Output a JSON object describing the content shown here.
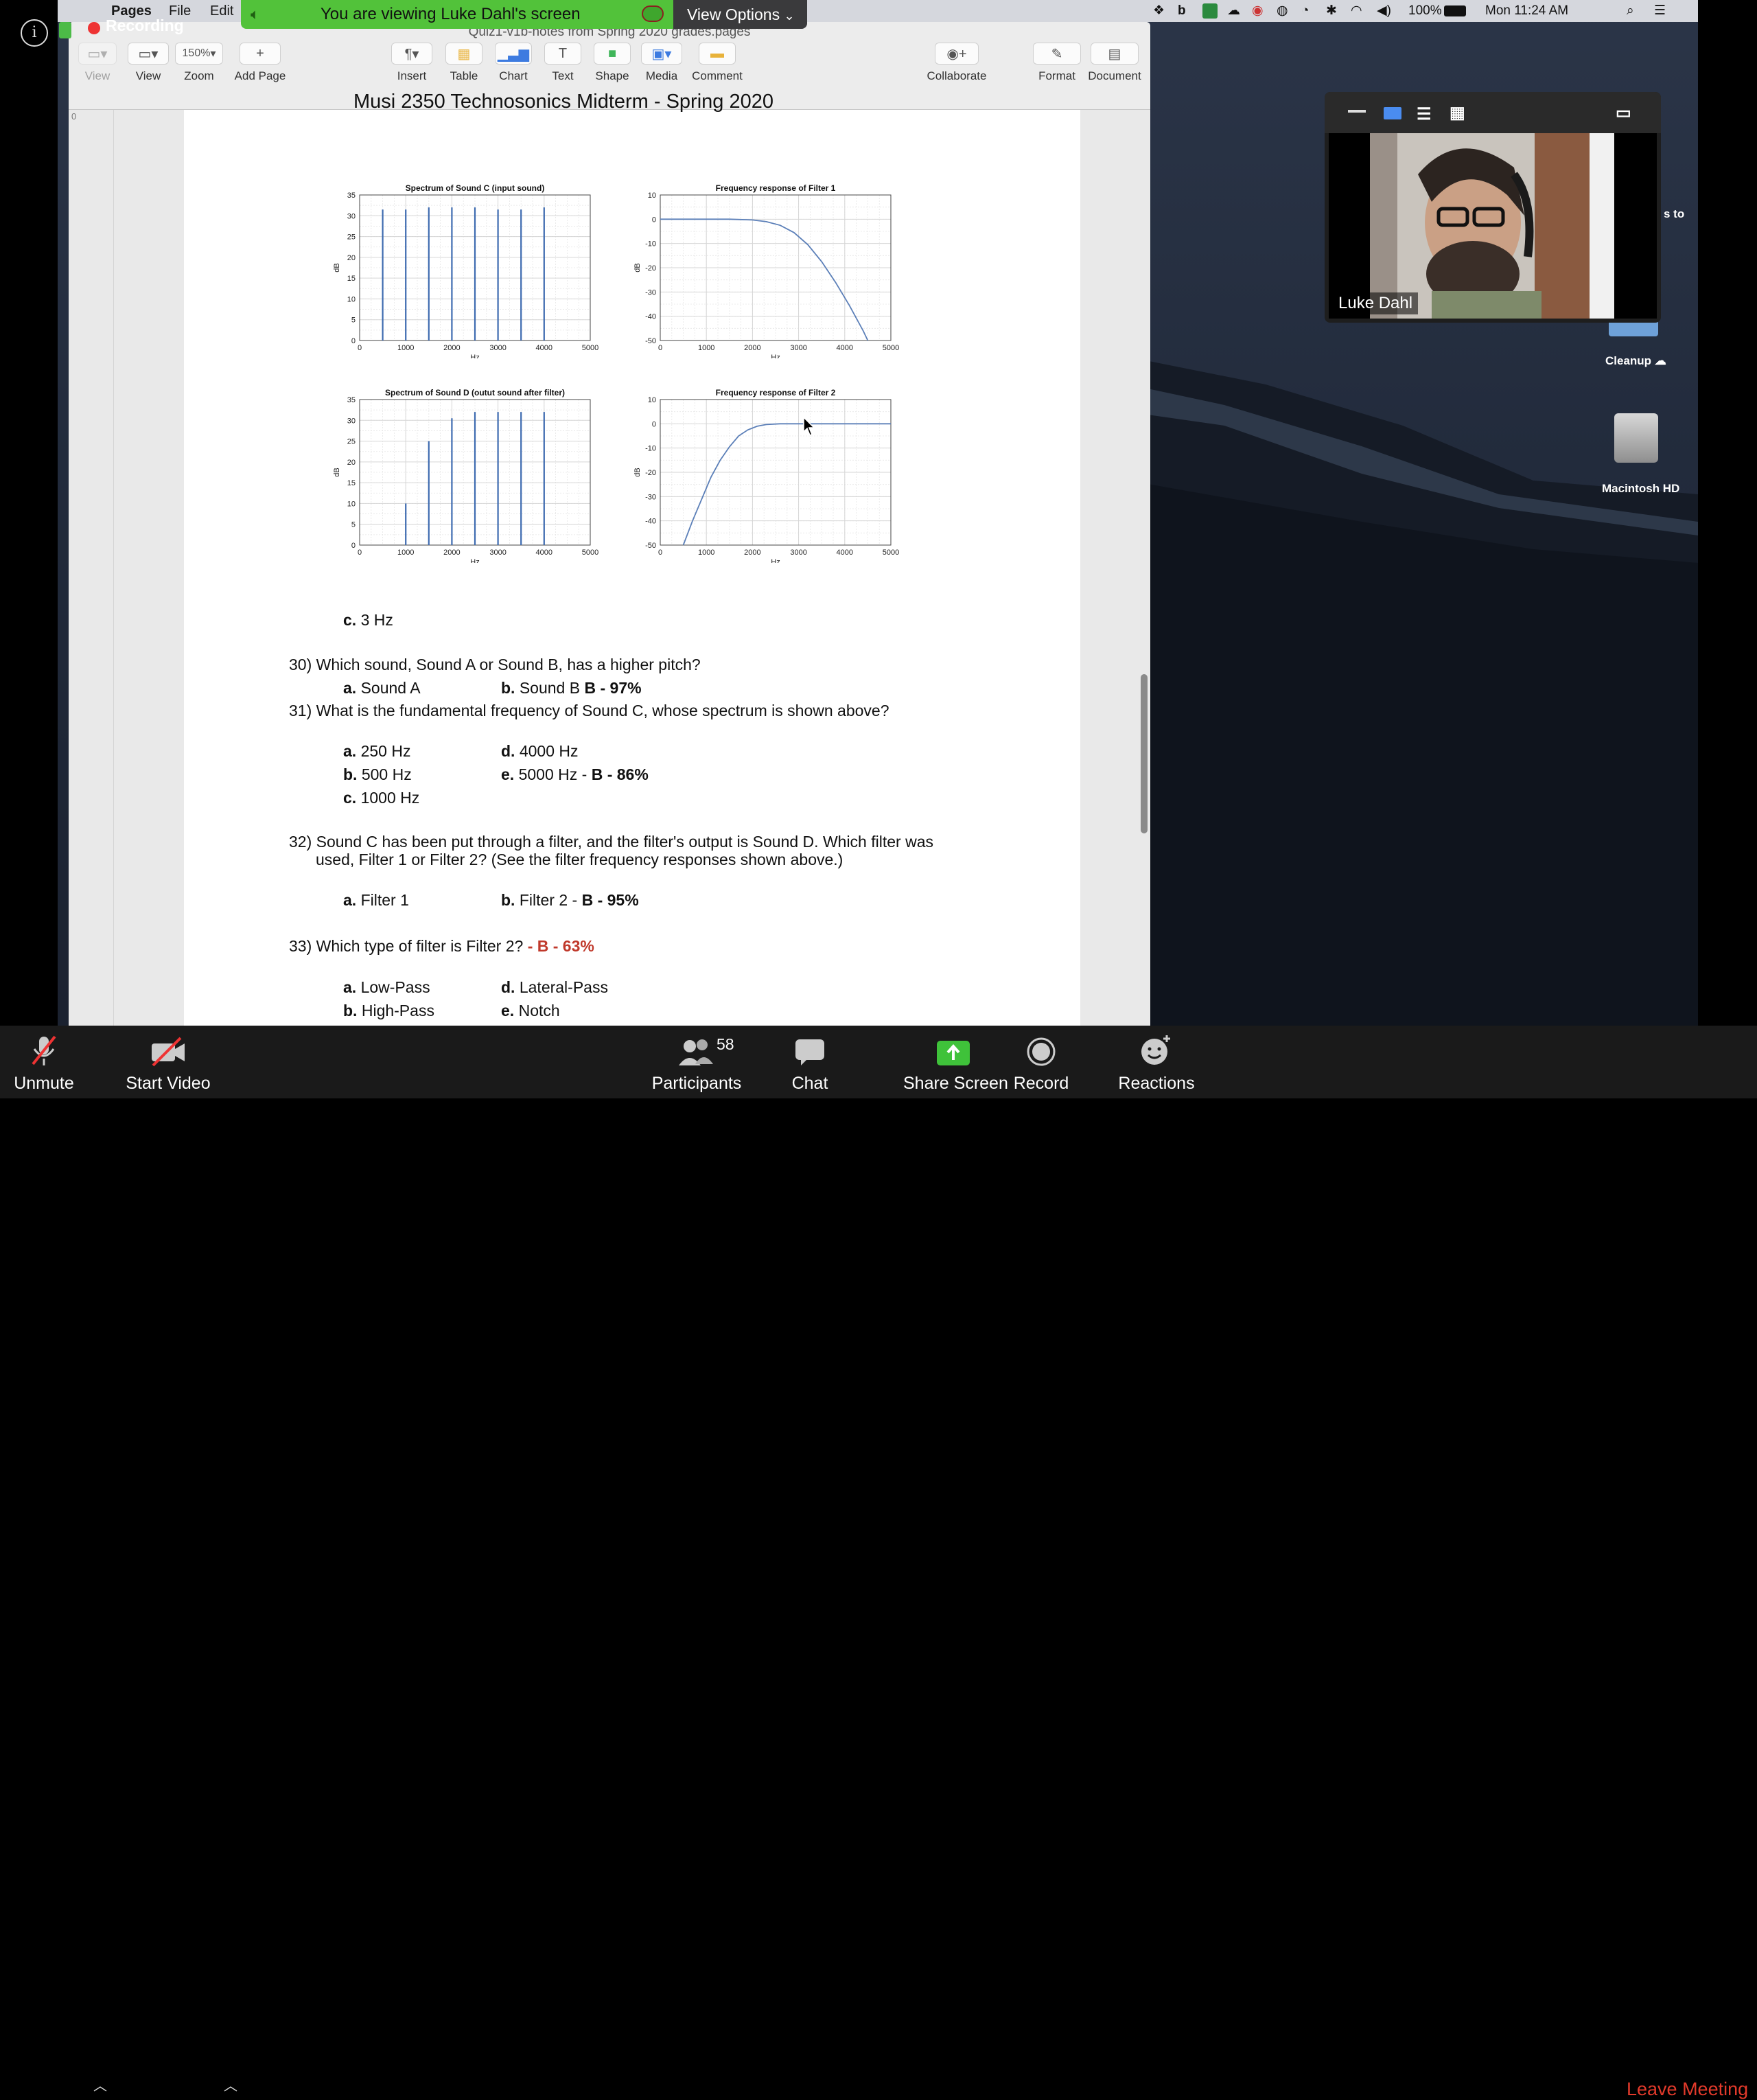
{
  "menubar": {
    "app_name": "Pages",
    "menus": [
      "File",
      "Edit"
    ],
    "battery": "100%",
    "clock": "Mon 11:24 AM"
  },
  "zoom_banner": {
    "viewing_text": "You are viewing Luke Dahl's screen",
    "view_options_label": "View Options",
    "recording_label": "Recording"
  },
  "pages": {
    "window_title": "Quiz1-v1b-notes from Spring 2020 grades.pages",
    "toolbar": {
      "view": "View",
      "zoom_value": "150%",
      "zoom": "Zoom",
      "add_page": "Add Page",
      "insert": "Insert",
      "table": "Table",
      "chart": "Chart",
      "text": "Text",
      "shape": "Shape",
      "media": "Media",
      "comment": "Comment",
      "collaborate": "Collaborate",
      "format": "Format",
      "document": "Document"
    },
    "ruler_zero": "0"
  },
  "document": {
    "title": "Musi 2350 Technosonics Midterm - Spring 2020",
    "q29_option_c_letter": "c.",
    "q29_option_c": "3 Hz",
    "q30": {
      "question": "30) Which sound, Sound A or Sound B, has a higher pitch?",
      "a_letter": "a.",
      "a": "Sound A",
      "b_letter": "b.",
      "b": "Sound B",
      "b_result": "B - 97%"
    },
    "q31": {
      "question": "31) What is the fundamental frequency of Sound C, whose spectrum is shown above?",
      "a_letter": "a.",
      "a": "250 Hz",
      "b_letter": "b.",
      "b": "500 Hz",
      "c_letter": "c.",
      "c": "1000 Hz",
      "d_letter": "d.",
      "d": "4000 Hz",
      "e_letter": "e.",
      "e": "5000 Hz -",
      "e_result": "B - 86%"
    },
    "q32": {
      "question_line1": "32) Sound C has been put through a filter, and the filter's output is Sound D. Which filter was",
      "question_line2": "used, Filter 1 or Filter 2? (See the filter frequency responses shown above.)",
      "a_letter": "a.",
      "a": "Filter 1",
      "b_letter": "b.",
      "b": "Filter 2 -",
      "b_result": "B - 95%"
    },
    "q33": {
      "question": "33) Which type of filter is Filter 2?",
      "result": "- B - 63%",
      "a_letter": "a.",
      "a": "Low-Pass",
      "b_letter": "b.",
      "b": "High-Pass",
      "d_letter": "d.",
      "d": "Lateral-Pass",
      "e_letter": "e.",
      "e": "Notch"
    }
  },
  "chart_data": [
    {
      "type": "bar",
      "title": "Spectrum of Sound C (input sound)",
      "xlabel": "Hz",
      "ylabel": "dB",
      "x": [
        500,
        1000,
        1500,
        2000,
        2500,
        3000,
        3500,
        4000
      ],
      "values": [
        31.5,
        31.5,
        32,
        32,
        32,
        31.5,
        31.5,
        32
      ],
      "xlim": [
        0,
        5000
      ],
      "ylim": [
        0,
        35
      ],
      "xticks": [
        0,
        1000,
        2000,
        3000,
        4000,
        5000
      ],
      "yticks": [
        0,
        5,
        10,
        15,
        20,
        25,
        30,
        35
      ],
      "color": "#3e6bb0",
      "grid": true
    },
    {
      "type": "line",
      "title": "Frequency response of Filter 1",
      "xlabel": "Hz",
      "ylabel": "dB",
      "x": [
        0,
        500,
        1000,
        1500,
        2000,
        2300,
        2600,
        2900,
        3200,
        3500,
        3800,
        4100,
        4400,
        4500
      ],
      "y": [
        0,
        0,
        0,
        0,
        -0.3,
        -1,
        -2.5,
        -5.5,
        -10.5,
        -17.5,
        -26,
        -35.5,
        -46,
        -50
      ],
      "xlim": [
        0,
        5000
      ],
      "ylim": [
        -50,
        10
      ],
      "xticks": [
        0,
        1000,
        2000,
        3000,
        4000,
        5000
      ],
      "yticks": [
        10,
        0,
        -10,
        -20,
        -30,
        -40,
        -50
      ],
      "color": "#5b7fb8",
      "grid": true
    },
    {
      "type": "bar",
      "title": "Spectrum of Sound D (outut sound after filter)",
      "xlabel": "Hz",
      "ylabel": "dB",
      "x": [
        1000,
        1500,
        2000,
        2500,
        3000,
        3500,
        4000
      ],
      "values": [
        10,
        25,
        30.5,
        32,
        32,
        32,
        32
      ],
      "xlim": [
        0,
        5000
      ],
      "ylim": [
        0,
        35
      ],
      "xticks": [
        0,
        1000,
        2000,
        3000,
        4000,
        5000
      ],
      "yticks": [
        0,
        5,
        10,
        15,
        20,
        25,
        30,
        35
      ],
      "color": "#3e6bb0",
      "grid": true
    },
    {
      "type": "line",
      "title": "Frequency response of Filter 2",
      "xlabel": "Hz",
      "ylabel": "dB",
      "x": [
        500,
        700,
        900,
        1100,
        1300,
        1500,
        1700,
        1900,
        2100,
        2300,
        2600,
        3000,
        4000,
        5000
      ],
      "y": [
        -50,
        -40,
        -31,
        -22,
        -15,
        -9.5,
        -5,
        -2.5,
        -1,
        -0.3,
        0,
        0,
        0,
        0
      ],
      "xlim": [
        0,
        5000
      ],
      "ylim": [
        -50,
        10
      ],
      "xticks": [
        0,
        1000,
        2000,
        3000,
        4000,
        5000
      ],
      "yticks": [
        10,
        0,
        -10,
        -20,
        -30,
        -40,
        -50
      ],
      "color": "#5b7fb8",
      "grid": true
    }
  ],
  "video_panel": {
    "participant_name": "Luke Dahl"
  },
  "desktop": {
    "partial_text": "s to",
    "cleanup_label": "Cleanup",
    "hd_label": "Macintosh HD"
  },
  "zoom_bar": {
    "unmute": "Unmute",
    "start_video": "Start Video",
    "participants": "Participants",
    "participant_count": "58",
    "chat": "Chat",
    "share_screen": "Share Screen",
    "record": "Record",
    "reactions": "Reactions",
    "leave": "Leave Meeting"
  }
}
